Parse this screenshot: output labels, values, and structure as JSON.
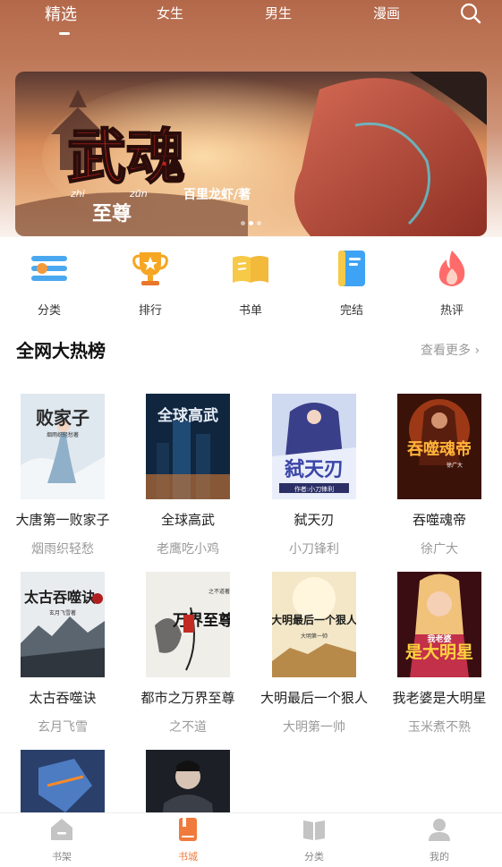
{
  "header": {
    "tabs": [
      {
        "label": "精选",
        "active": true
      },
      {
        "label": "女生"
      },
      {
        "label": "男生"
      },
      {
        "label": "漫画"
      }
    ],
    "search_icon": "search-icon"
  },
  "banner": {
    "title_big": "武魂",
    "title_small": "至尊",
    "pinyin_1": "zhi",
    "pinyin_2": "zūn",
    "author": "百里龙虾/著",
    "page_count": 3,
    "active_index": 1
  },
  "quick_nav": [
    {
      "label": "分类",
      "icon": "category-icon",
      "color": "#4aa8f0"
    },
    {
      "label": "排行",
      "icon": "trophy-icon",
      "color": "#f6a623"
    },
    {
      "label": "书单",
      "icon": "book-list-icon",
      "color": "#f7c948"
    },
    {
      "label": "完结",
      "icon": "finished-book-icon",
      "color": "#3ea3f5"
    },
    {
      "label": "热评",
      "icon": "fire-icon",
      "color": "#ff6b6b"
    }
  ],
  "hot_list": {
    "title": "全网大热榜",
    "more": "查看更多 ›",
    "books": [
      {
        "title": "大唐第一败家子",
        "author": "烟雨织轻愁",
        "cover_text": "败家子",
        "cover_sub": "烟雨织轻愁著"
      },
      {
        "title": "全球高武",
        "author": "老鹰吃小鸡",
        "cover_text": "全球高武",
        "cover_sub": ""
      },
      {
        "title": "弑天刃",
        "author": "小刀锋利",
        "cover_text": "弑天刃",
        "cover_sub": "作者:小刀锋利"
      },
      {
        "title": "吞噬魂帝",
        "author": "徐广大",
        "cover_text": "吞噬魂帝",
        "cover_sub": "徐广大"
      },
      {
        "title": "太古吞噬诀",
        "author": "玄月飞雪",
        "cover_text": "太古吞噬诀",
        "cover_sub": "玄月飞雪著"
      },
      {
        "title": "都市之万界至尊",
        "author": "之不道",
        "cover_text": "万界至尊",
        "cover_sub": "之不道著"
      },
      {
        "title": "大明最后一个狠人",
        "author": "大明第一帅",
        "cover_text": "大明最后一个狠人",
        "cover_sub": "大明第一帅"
      },
      {
        "title": "我老婆是大明星",
        "author": "玉米煮不熟",
        "cover_text": "是大明星",
        "cover_sub": "我老婆"
      },
      {
        "title": "",
        "author": "",
        "cover_text": "",
        "cover_sub": ""
      },
      {
        "title": "",
        "author": "",
        "cover_text": "",
        "cover_sub": ""
      }
    ]
  },
  "bottom_nav": [
    {
      "label": "书架",
      "icon": "bookshelf-icon"
    },
    {
      "label": "书城",
      "icon": "bookstore-icon",
      "active": true
    },
    {
      "label": "分类",
      "icon": "category-book-icon"
    },
    {
      "label": "我的",
      "icon": "user-icon"
    }
  ],
  "colors": {
    "accent": "#f07a3c",
    "muted": "#9a9a9a"
  }
}
